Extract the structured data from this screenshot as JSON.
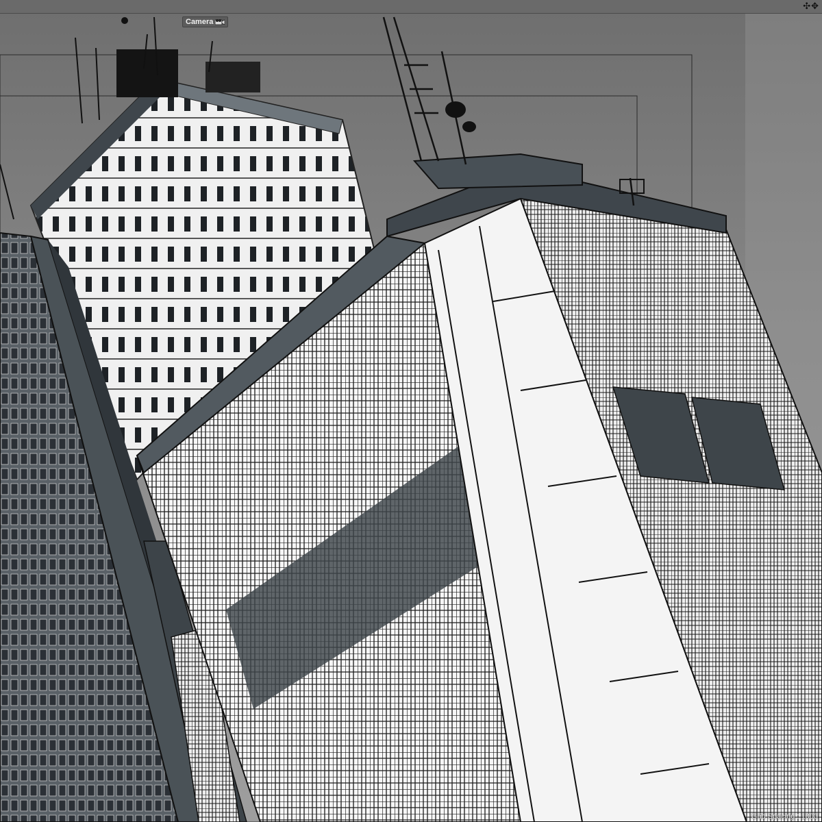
{
  "viewport": {
    "camera_label": "Camera",
    "camera_icon": "camera-icon",
    "nav_icons": "✣✥",
    "status_text": "Grid Spacing : 1000"
  },
  "colors": {
    "background": "#8a8a8a",
    "building_dark": "#3f464c",
    "building_light": "#e8e8e8",
    "glass": "#f2f2f2",
    "frame_line": "#000000"
  }
}
